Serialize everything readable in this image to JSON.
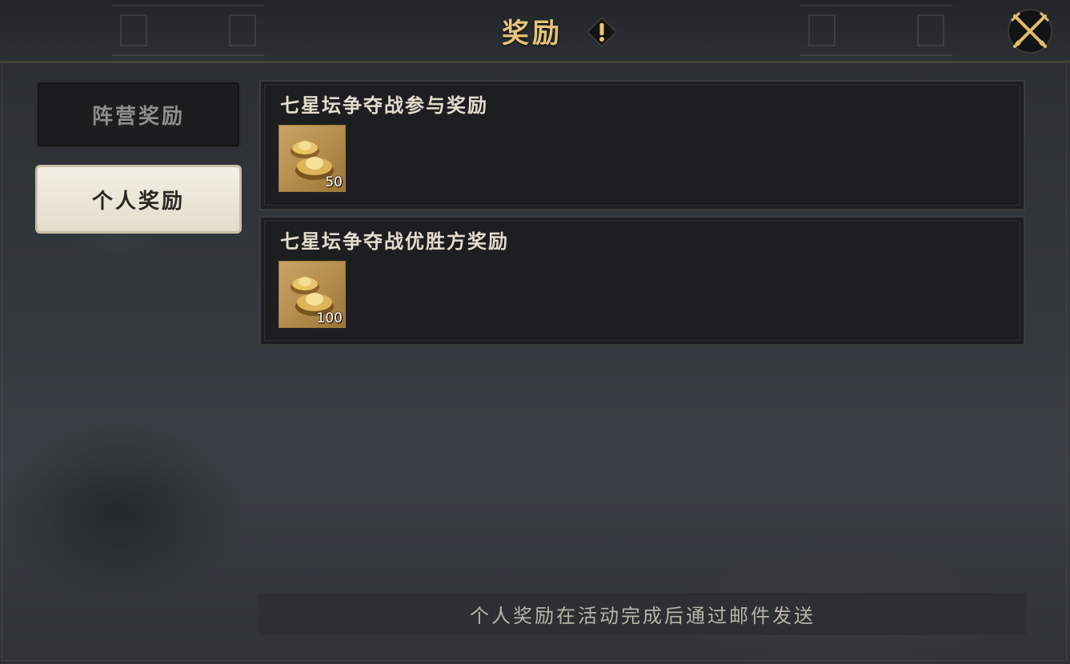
{
  "header": {
    "title": "奖励",
    "info_icon": "exclamation-diamond-icon",
    "close_icon": "crossed-swords-close-icon"
  },
  "sidebar": {
    "tabs": [
      {
        "label": "阵营奖励",
        "selected": false
      },
      {
        "label": "个人奖励",
        "selected": true
      }
    ]
  },
  "rewards": [
    {
      "title": "七星坛争夺战参与奖励",
      "items": [
        {
          "icon": "gold-ingot-icon",
          "quantity": "50"
        }
      ]
    },
    {
      "title": "七星坛争夺战优胜方奖励",
      "items": [
        {
          "icon": "gold-ingot-icon",
          "quantity": "100"
        }
      ]
    }
  ],
  "notice": "个人奖励在活动完成后通过邮件发送",
  "colors": {
    "title_gold": "#e6c47a",
    "panel_bg": "#1d1e20",
    "selected_tab": "#efe9dc"
  }
}
